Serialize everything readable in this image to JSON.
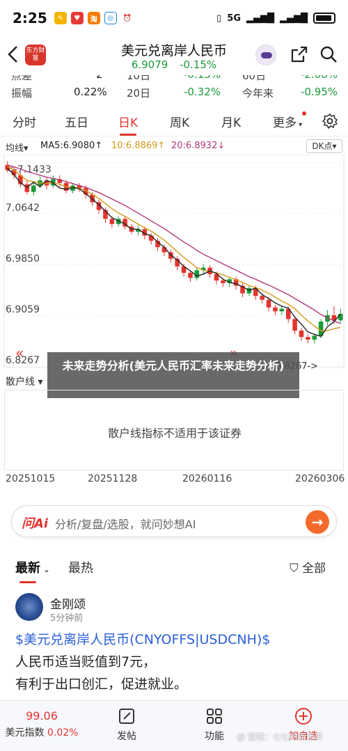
{
  "status_bar": {
    "time": "2:25",
    "signal": "5G",
    "battery_level": 0.75,
    "app_icons": [
      "notes-app-icon",
      "pdd-app-icon",
      "taobao-app-icon",
      "disk-app-icon",
      "alarm-icon"
    ]
  },
  "header": {
    "back_icon": "chevron-left-icon",
    "logo_text": "东方财富",
    "title": "美元兑离岸人民币",
    "price": "6.9079",
    "change_pct": "-0.15%",
    "change_color": "#1a9a3a"
  },
  "stats": {
    "row1": {
      "label1": "点差",
      "value1": "2",
      "label2": "10日",
      "value2": "-0.15%",
      "label3": "60日",
      "value3": "-2.08%"
    },
    "row2": {
      "label1": "振幅",
      "value1": "0.22%",
      "label2": "20日",
      "value2": "-0.32%",
      "label3": "今年来",
      "value3": "-0.95%"
    }
  },
  "period_tabs": [
    "分时",
    "五日",
    "日K",
    "周K",
    "月K",
    "更多"
  ],
  "active_tab": "日K",
  "ma": {
    "selector": "均线",
    "ma5": "MA5:6.9080",
    "ma10": "10:6.8869",
    "ma20": "20:6.8932",
    "ma5_color": "#222222",
    "ma10_color": "#d39a1c",
    "ma20_color": "#b03a7a",
    "dk_label": "DK点"
  },
  "chart_data": {
    "type": "candlestick",
    "y_ticks": [
      "7.1433",
      "7.0642",
      "6.9850",
      "6.9059",
      "6.8267"
    ],
    "ylim": [
      6.8267,
      7.1433
    ],
    "max_label": "7.1433",
    "min_label": "6.8267",
    "up_color": "#1a9a3a",
    "down_color": "#e3342f",
    "x_dates": [
      "20251015",
      "20251128",
      "20260116",
      "20260306"
    ],
    "ma5": [
      7.135,
      7.125,
      7.112,
      7.105,
      7.113,
      7.106,
      7.116,
      7.112,
      7.104,
      7.102,
      7.105,
      7.103,
      7.095,
      7.087,
      7.078,
      7.068,
      7.058,
      7.053,
      7.048,
      7.04,
      7.04,
      7.033,
      7.03,
      7.02,
      7.012,
      7.0,
      6.992,
      6.982,
      6.975,
      6.967,
      6.97,
      6.975,
      6.971,
      6.962,
      6.957,
      6.955,
      6.95,
      6.945,
      6.948,
      6.938,
      6.932,
      6.925,
      6.92,
      6.917,
      6.903,
      6.892,
      6.88,
      6.876,
      6.873,
      6.888,
      6.896,
      6.908
    ],
    "ma10": [
      7.138,
      7.132,
      7.124,
      7.116,
      7.114,
      7.112,
      7.111,
      7.112,
      7.11,
      7.106,
      7.105,
      7.104,
      7.1,
      7.094,
      7.088,
      7.08,
      7.072,
      7.065,
      7.06,
      7.054,
      7.048,
      7.042,
      7.037,
      7.03,
      7.023,
      7.014,
      7.005,
      6.996,
      6.988,
      6.98,
      6.976,
      6.974,
      6.972,
      6.969,
      6.965,
      6.961,
      6.957,
      6.952,
      6.949,
      6.945,
      6.94,
      6.934,
      6.928,
      6.923,
      6.916,
      6.906,
      6.897,
      6.889,
      6.882,
      6.882,
      6.885,
      6.887
    ],
    "ma20": [
      7.14,
      7.137,
      7.134,
      7.13,
      7.127,
      7.124,
      7.121,
      7.119,
      7.117,
      7.114,
      7.111,
      7.108,
      7.105,
      7.101,
      7.097,
      7.092,
      7.087,
      7.082,
      7.077,
      7.071,
      7.065,
      7.059,
      7.053,
      7.047,
      7.041,
      7.034,
      7.027,
      7.02,
      7.014,
      7.007,
      7.001,
      6.996,
      6.991,
      6.986,
      6.981,
      6.976,
      6.971,
      6.966,
      6.962,
      6.957,
      6.953,
      6.948,
      6.943,
      6.938,
      6.932,
      6.926,
      6.92,
      6.914,
      6.907,
      6.902,
      6.897,
      6.893
    ],
    "candles": [
      [
        7.14,
        7.132,
        7.146,
        7.128
      ],
      [
        7.132,
        7.124,
        7.138,
        7.118
      ],
      [
        7.124,
        7.11,
        7.128,
        7.105
      ],
      [
        7.11,
        7.098,
        7.116,
        7.094
      ],
      [
        7.098,
        7.108,
        7.112,
        7.092
      ],
      [
        7.108,
        7.116,
        7.122,
        7.104
      ],
      [
        7.116,
        7.108,
        7.12,
        7.102
      ],
      [
        7.108,
        7.118,
        7.124,
        7.104
      ],
      [
        7.118,
        7.112,
        7.124,
        7.106
      ],
      [
        7.112,
        7.1,
        7.116,
        7.096
      ],
      [
        7.1,
        7.108,
        7.112,
        7.096
      ],
      [
        7.108,
        7.104,
        7.112,
        7.098
      ],
      [
        7.104,
        7.094,
        7.108,
        7.088
      ],
      [
        7.094,
        7.082,
        7.098,
        7.076
      ],
      [
        7.082,
        7.07,
        7.086,
        7.064
      ],
      [
        7.07,
        7.056,
        7.074,
        7.05
      ],
      [
        7.056,
        7.048,
        7.06,
        7.042
      ],
      [
        7.048,
        7.056,
        7.06,
        7.044
      ],
      [
        7.056,
        7.044,
        7.06,
        7.04
      ],
      [
        7.044,
        7.036,
        7.048,
        7.032
      ],
      [
        7.036,
        7.04,
        7.046,
        7.03
      ],
      [
        7.04,
        7.03,
        7.044,
        7.024
      ],
      [
        7.03,
        7.022,
        7.034,
        7.016
      ],
      [
        7.022,
        7.012,
        7.026,
        7.006
      ],
      [
        7.012,
        7.004,
        7.016,
        6.998
      ],
      [
        7.004,
        6.994,
        7.008,
        6.988
      ],
      [
        6.994,
        6.982,
        6.998,
        6.976
      ],
      [
        6.982,
        6.972,
        6.986,
        6.966
      ],
      [
        6.972,
        6.964,
        6.976,
        6.958
      ],
      [
        6.964,
        6.976,
        6.98,
        6.96
      ],
      [
        6.976,
        6.98,
        6.986,
        6.97
      ],
      [
        6.98,
        6.97,
        6.984,
        6.964
      ],
      [
        6.97,
        6.96,
        6.974,
        6.954
      ],
      [
        6.96,
        6.956,
        6.964,
        6.95
      ],
      [
        6.956,
        6.962,
        6.966,
        6.95
      ],
      [
        6.962,
        6.952,
        6.966,
        6.946
      ],
      [
        6.952,
        6.94,
        6.956,
        6.934
      ],
      [
        6.94,
        6.948,
        6.952,
        6.936
      ],
      [
        6.948,
        6.936,
        6.952,
        6.93
      ],
      [
        6.936,
        6.93,
        6.94,
        6.924
      ],
      [
        6.93,
        6.918,
        6.934,
        6.912
      ],
      [
        6.918,
        6.912,
        6.922,
        6.906
      ],
      [
        6.912,
        6.916,
        6.92,
        6.906
      ],
      [
        6.916,
        6.9,
        6.92,
        6.894
      ],
      [
        6.9,
        6.882,
        6.904,
        6.876
      ],
      [
        6.882,
        6.872,
        6.886,
        6.866
      ],
      [
        6.872,
        6.868,
        6.876,
        6.862
      ],
      [
        6.868,
        6.874,
        6.878,
        6.862
      ],
      [
        6.874,
        6.896,
        6.9,
        6.87
      ],
      [
        6.896,
        6.906,
        6.914,
        6.89
      ],
      [
        6.906,
        6.898,
        6.92,
        6.892
      ],
      [
        6.898,
        6.908,
        6.916,
        6.894
      ]
    ]
  },
  "chart_nav": {
    "prev_arrow": "«",
    "next_arrow": "»",
    "min_marker": "6.8267->"
  },
  "banner_text": "未来走势分析(美元人民币汇率未来走势分析)",
  "sub_indicator": {
    "selector": "散户线",
    "note": "散户线指标不适用于该证券"
  },
  "ask_ai": {
    "logo": "问Ai",
    "placeholder": "分析/复盘/选股，就问妙想AI",
    "go_icon": "arrow-right-icon"
  },
  "feed": {
    "tabs": [
      "最新",
      "最热"
    ],
    "active": "最新",
    "filter_label": "全部",
    "post": {
      "author": "金刚颂",
      "time": "5分钟前",
      "tag": "$美元兑离岸人民币(CNYOFFS|USDCNH)$",
      "lines": [
        "人民币适当贬值到7元，",
        "有利于出口创汇，促进就业。"
      ]
    }
  },
  "bottom_bar": {
    "index_value": "99.06",
    "index_label": "美元指数",
    "index_change": "0.02%",
    "post_label": "发帖",
    "func_label": "功能",
    "watch_label": "加自选"
  },
  "watermark": "@ 雪球：七七的新世界"
}
